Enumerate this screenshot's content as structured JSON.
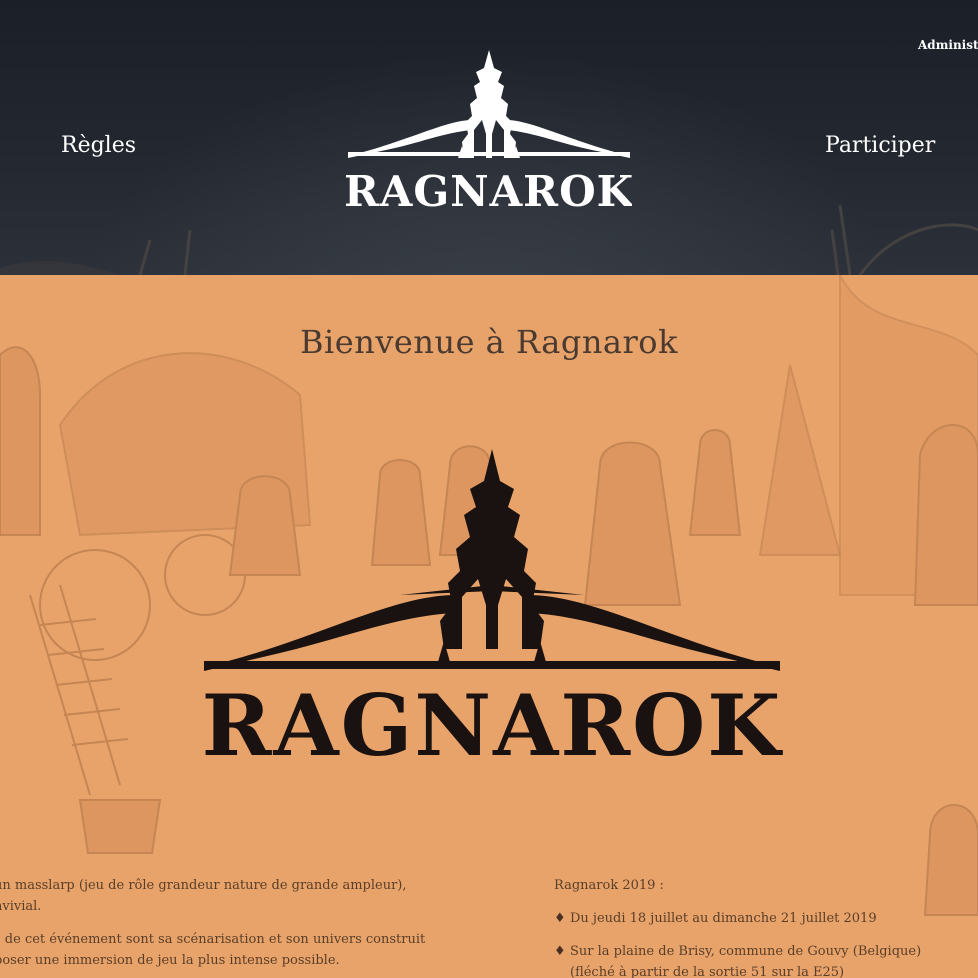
{
  "header": {
    "admin_link": "Administr",
    "nav_left": "Règles",
    "nav_right": "Participer",
    "logo_text": "RAGNAROK",
    "colors": {
      "background": "#1f232b",
      "text": "#ffffff"
    }
  },
  "main": {
    "title": "Bienvenue à Ragnarok",
    "logo_text": "RAGNAROK",
    "intro_paragraphs": [
      "un masslarp (jeu de rôle grandeur nature de grande ampleur),",
      "nvivial.",
      "s de cet événement sont sa scénarisation et son univers construit",
      "poser une immersion de jeu la plus intense possible."
    ],
    "event": {
      "title": "Ragnarok 2019 :",
      "items": [
        {
          "icon": "diamond-bullet-icon",
          "text": "Du jeudi 18 juillet au dimanche 21 juillet 2019",
          "sub": ""
        },
        {
          "icon": "diamond-bullet-icon",
          "text": "Sur la plaine de Brisy, commune de Gouvy (Belgique)",
          "sub": "(fléché à partir de la sortie 51 sur la E25)"
        }
      ]
    },
    "colors": {
      "background": "#e8a36a",
      "text": "#5a3e28",
      "title": "#4a3a30",
      "logo": "#1a1210"
    }
  }
}
